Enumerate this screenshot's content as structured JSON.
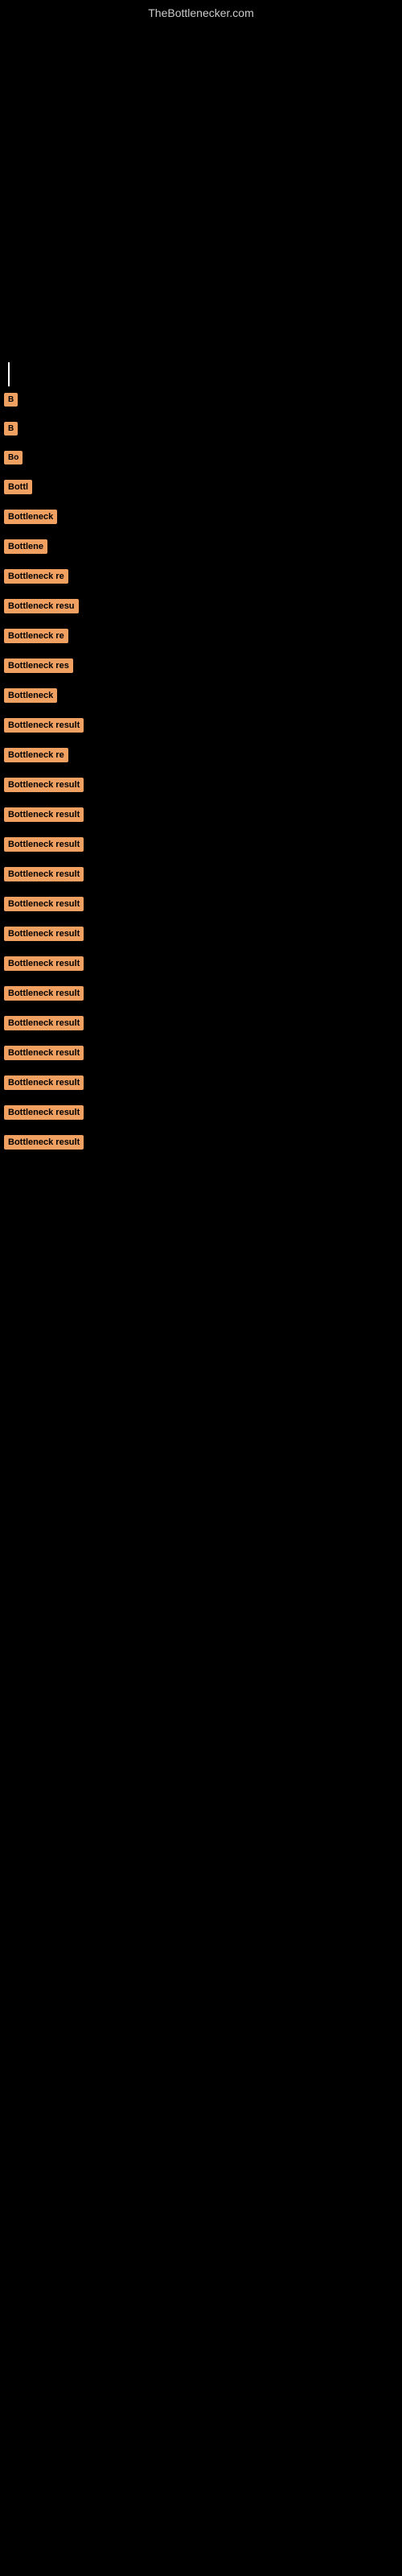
{
  "site": {
    "title": "TheBottlenecker.com"
  },
  "bottleneck_items": [
    {
      "id": 1,
      "label": "B",
      "width_class": "w-tiny"
    },
    {
      "id": 2,
      "label": "B",
      "width_class": "w-small"
    },
    {
      "id": 3,
      "label": "Bo",
      "width_class": "w-sm2"
    },
    {
      "id": 4,
      "label": "Bottl",
      "width_class": "w-med1"
    },
    {
      "id": 5,
      "label": "Bottleneck",
      "width_class": "w-med2"
    },
    {
      "id": 6,
      "label": "Bottlene",
      "width_class": "w-med3"
    },
    {
      "id": 7,
      "label": "Bottleneck re",
      "width_class": "w-med4"
    },
    {
      "id": 8,
      "label": "Bottleneck resu",
      "width_class": "w-med5"
    },
    {
      "id": 9,
      "label": "Bottleneck re",
      "width_class": "w-med6"
    },
    {
      "id": 10,
      "label": "Bottleneck res",
      "width_class": "w-med7"
    },
    {
      "id": 11,
      "label": "Bottleneck",
      "width_class": "w-large1"
    },
    {
      "id": 12,
      "label": "Bottleneck result",
      "width_class": "w-large2"
    },
    {
      "id": 13,
      "label": "Bottleneck re",
      "width_class": "w-large3"
    },
    {
      "id": 14,
      "label": "Bottleneck result",
      "width_class": "w-large4"
    },
    {
      "id": 15,
      "label": "Bottleneck result",
      "width_class": "w-large5"
    },
    {
      "id": 16,
      "label": "Bottleneck result",
      "width_class": "w-large6"
    },
    {
      "id": 17,
      "label": "Bottleneck result",
      "width_class": "w-large7"
    },
    {
      "id": 18,
      "label": "Bottleneck result",
      "width_class": "w-large8"
    },
    {
      "id": 19,
      "label": "Bottleneck result",
      "width_class": "w-large9"
    },
    {
      "id": 20,
      "label": "Bottleneck result",
      "width_class": "w-large10"
    },
    {
      "id": 21,
      "label": "Bottleneck result",
      "width_class": "w-large11"
    },
    {
      "id": 22,
      "label": "Bottleneck result",
      "width_class": "w-large12"
    },
    {
      "id": 23,
      "label": "Bottleneck result",
      "width_class": "w-large13"
    },
    {
      "id": 24,
      "label": "Bottleneck result",
      "width_class": "w-large14"
    },
    {
      "id": 25,
      "label": "Bottleneck result",
      "width_class": "w-large15"
    },
    {
      "id": 26,
      "label": "Bottleneck result",
      "width_class": "w-large15"
    }
  ]
}
